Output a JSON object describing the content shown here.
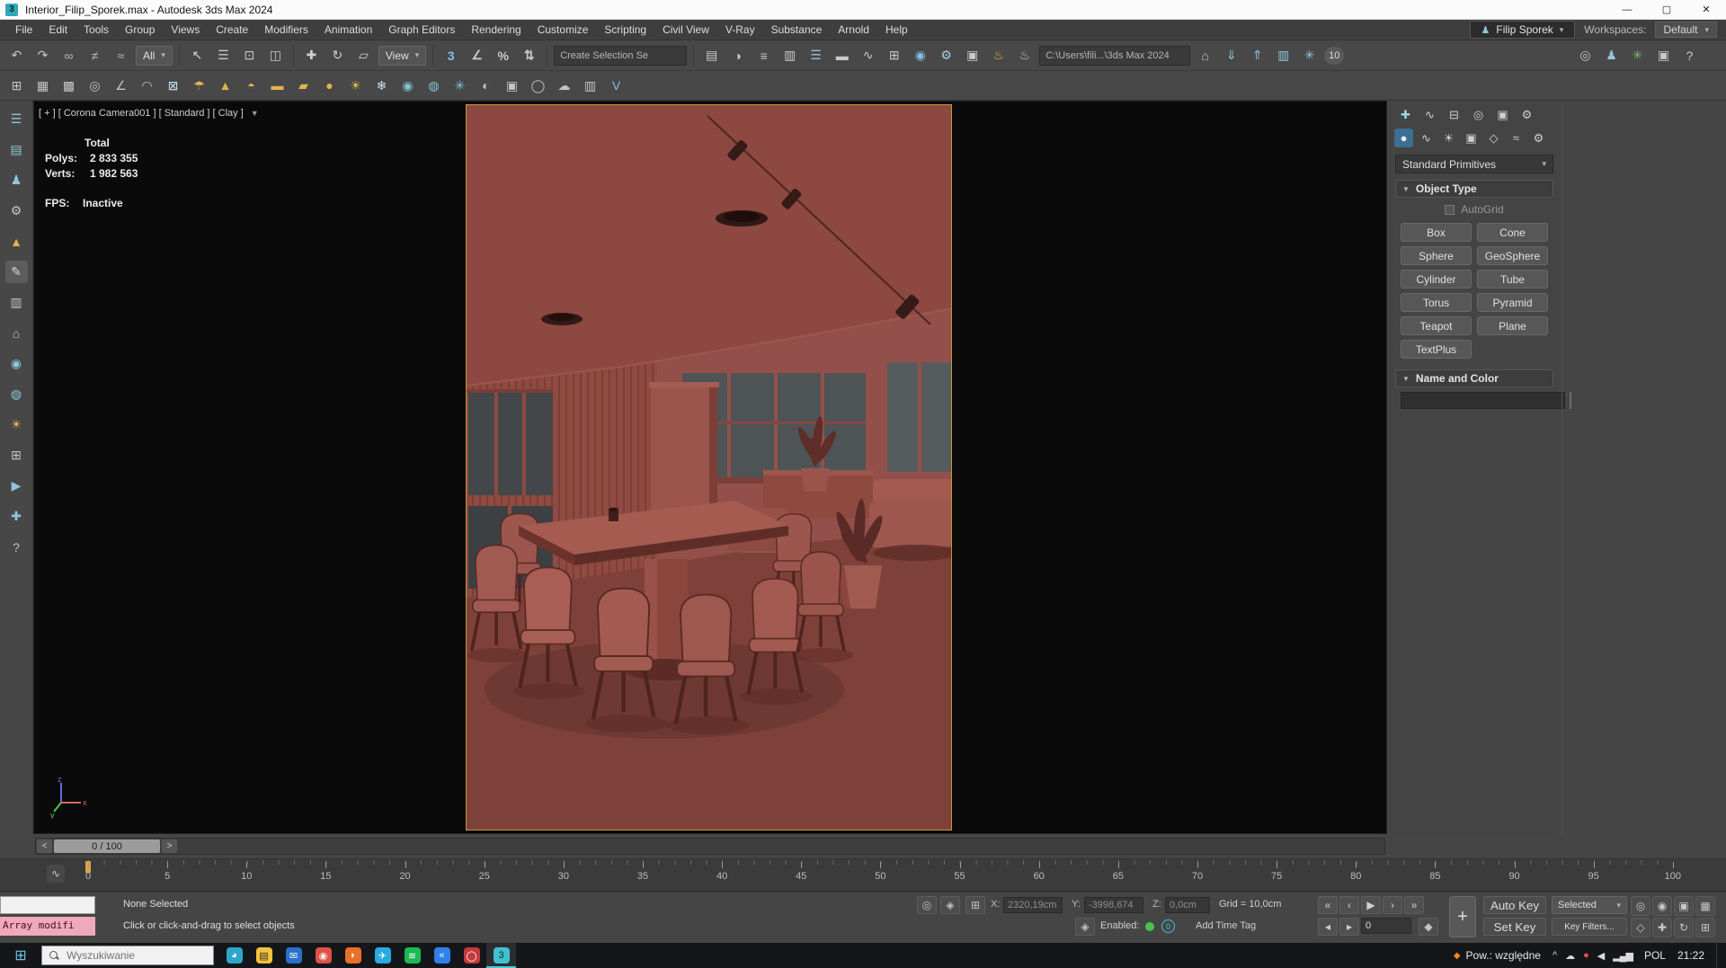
{
  "window": {
    "title": "Interior_Filip_Sporek.max - Autodesk 3ds Max 2024",
    "app_badge": "3",
    "minimize": "—",
    "maximize": "▢",
    "close": "✕"
  },
  "menu": {
    "items": [
      "File",
      "Edit",
      "Tools",
      "Group",
      "Views",
      "Create",
      "Modifiers",
      "Animation",
      "Graph Editors",
      "Rendering",
      "Customize",
      "Scripting",
      "Civil View",
      "V-Ray",
      "Substance",
      "Arnold",
      "Help"
    ],
    "user": "Filip Sporek",
    "user_icon": "♟",
    "workspaces_label": "Workspaces:",
    "workspace": "Default"
  },
  "toolbar_main": {
    "history_icons": [
      {
        "n": "undo-icon",
        "g": "↶",
        "c": "#c9c9c9"
      },
      {
        "n": "redo-icon",
        "g": "↷",
        "c": "#c9c9c9"
      },
      {
        "n": "select-and-link-icon",
        "g": "∞",
        "c": "#b8b8b8"
      },
      {
        "n": "unlink-selection-icon",
        "g": "≠",
        "c": "#b8b8b8"
      },
      {
        "n": "bind-to-space-warp-icon",
        "g": "≈",
        "c": "#b8b8b8"
      }
    ],
    "filter_dd": "All",
    "select_icons": [
      {
        "n": "select-object-icon",
        "g": "↖",
        "c": "#d8d8d8"
      },
      {
        "n": "select-by-name-icon",
        "g": "☰",
        "c": "#c9c9c9"
      },
      {
        "n": "rectangular-selection-icon",
        "g": "⊡",
        "c": "#c9c9c9"
      },
      {
        "n": "window-crossing-icon",
        "g": "◫",
        "c": "#c9c9c9"
      }
    ],
    "transform_icons": [
      {
        "n": "select-and-move-icon",
        "g": "✚",
        "c": "#d0d0d0"
      },
      {
        "n": "select-and-rotate-icon",
        "g": "↻",
        "c": "#d0d0d0"
      },
      {
        "n": "select-and-scale-icon",
        "g": "▱",
        "c": "#d0d0d0"
      }
    ],
    "view_dd": "View",
    "snap_icons": [
      {
        "n": "snaps-toggle-icon",
        "g": "3",
        "c": "#7ec1e0"
      },
      {
        "n": "angle-snap-icon",
        "g": "∠",
        "c": "#c9c9c9"
      },
      {
        "n": "percent-snap-icon",
        "g": "%",
        "c": "#c9c9c9"
      },
      {
        "n": "spinner-snap-icon",
        "g": "⇅",
        "c": "#c9c9c9"
      }
    ],
    "selection_set": "Create Selection Se",
    "edit_icons": [
      {
        "n": "edit-named-selections-icon",
        "g": "▤",
        "c": "#c9c9c9"
      },
      {
        "n": "mirror-icon",
        "g": "◑",
        "c": "#c9c9c9"
      },
      {
        "n": "align-icon",
        "g": "≡",
        "c": "#c9c9c9"
      },
      {
        "n": "layer-manager-icon",
        "g": "▥",
        "c": "#c9c9c9"
      },
      {
        "n": "scene-explorer-icon",
        "g": "☰",
        "c": "#8fc6d8"
      },
      {
        "n": "ribb0n-toggle-icon",
        "g": "▬",
        "c": "#c9c9c9"
      },
      {
        "n": "curve-editor-icon",
        "g": "∿",
        "c": "#c9c9c9"
      },
      {
        "n": "schematic-view-icon",
        "g": "⊞",
        "c": "#c9c9c9"
      },
      {
        "n": "material-editor-icon",
        "g": "◉",
        "c": "#7ec1e0"
      },
      {
        "n": "render-setup-icon",
        "g": "⚙",
        "c": "#9fd0e8"
      },
      {
        "n": "rendered-frame-icon",
        "g": "▣",
        "c": "#c9c9c9"
      },
      {
        "n": "render-production-icon",
        "g": "♨",
        "c": "#e3b34c"
      },
      {
        "n": "render-iterative-icon",
        "g": "♨",
        "c": "#9fd0e8"
      }
    ],
    "path": "C:\\Users\\fili...\\3ds Max 2024",
    "after_path_icons": [
      {
        "n": "project-folder-icon",
        "g": "⌂",
        "c": "#c9c9c9"
      },
      {
        "n": "import-icon",
        "g": "⇓",
        "c": "#8fc6d8"
      },
      {
        "n": "export-icon",
        "g": "⇑",
        "c": "#8fc6d8"
      },
      {
        "n": "open-script-icon",
        "g": "▥",
        "c": "#8fc6d8"
      },
      {
        "n": "mcg-icon",
        "g": "✳",
        "c": "#8fc6d8"
      }
    ],
    "badge": "10",
    "right_icons": [
      {
        "n": "arnold-icon",
        "g": "◎",
        "c": "#c9c9c9"
      },
      {
        "n": "populate-icon",
        "g": "♟",
        "c": "#8fc6d8"
      },
      {
        "n": "forest-icon",
        "g": "✳",
        "c": "#79b868"
      },
      {
        "n": "monitor-icon",
        "g": "▣",
        "c": "#c9c9c9"
      },
      {
        "n": "help-icon",
        "g": "?",
        "c": "#c9c9c9"
      }
    ]
  },
  "toolbar_second": {
    "icons": [
      {
        "n": "snap-grid-icon",
        "g": "⊞",
        "c": "#c4c4c4"
      },
      {
        "n": "modeling-ribbon-icon",
        "g": "▦",
        "c": "#c4c4c4"
      },
      {
        "n": "editable-poly-icon",
        "g": "▩",
        "c": "#c4c4c4"
      },
      {
        "n": "compass-icon",
        "g": "◎",
        "c": "#c4c4c4"
      },
      {
        "n": "measure-icon",
        "g": "∠",
        "c": "#c4c4c4"
      },
      {
        "n": "arc-tool-icon",
        "g": "◠",
        "c": "#c4c4c4"
      },
      {
        "n": "film-camera-icon",
        "g": "⊠",
        "c": "#bfe3ef"
      },
      {
        "n": "umbrella-light-icon",
        "g": "☂",
        "c": "#e3b34c"
      },
      {
        "n": "cone-light-icon",
        "g": "▲",
        "c": "#e3b34c"
      },
      {
        "n": "dome-light-icon",
        "g": "◓",
        "c": "#e3b34c"
      },
      {
        "n": "area-light-icon",
        "g": "▬",
        "c": "#e3b34c"
      },
      {
        "n": "plane-light-icon",
        "g": "▰",
        "c": "#e3b34c"
      },
      {
        "n": "sphere-light-icon",
        "g": "●",
        "c": "#e3b34c"
      },
      {
        "n": "sun-light-icon",
        "g": "☀",
        "c": "#e3b34c"
      },
      {
        "n": "snow-icon",
        "g": "❄",
        "c": "#cfe2ee"
      },
      {
        "n": "glass-sphere-icon",
        "g": "◉",
        "c": "#7fc3d8"
      },
      {
        "n": "soft-selection-icon",
        "g": "◍",
        "c": "#7fc3d8"
      },
      {
        "n": "cluster-icon",
        "g": "✳",
        "c": "#7fc3d8"
      },
      {
        "n": "camera-sequencer-icon",
        "g": "◐",
        "c": "#c4c4c4"
      },
      {
        "n": "physical-camera-icon",
        "g": "▣",
        "c": "#c4c4c4"
      },
      {
        "n": "lens-effects-icon",
        "g": "◯",
        "c": "#c4c4c4"
      },
      {
        "n": "environment-icon",
        "g": "☁",
        "c": "#c4c4c4"
      },
      {
        "n": "batch-render-icon",
        "g": "▥",
        "c": "#c4c4c4"
      },
      {
        "n": "vray-toolbar-icon",
        "g": "V",
        "c": "#8ab6e8"
      }
    ]
  },
  "left_toolbar": {
    "icons": [
      {
        "n": "scene-explorer-icon",
        "g": "☰",
        "c": "#8fc6d8",
        "cls": ""
      },
      {
        "n": "layer-explorer-icon",
        "g": "▤",
        "c": "#8fc6d8",
        "cls": ""
      },
      {
        "n": "character-icon",
        "g": "♟",
        "c": "#8fc6d8",
        "cls": ""
      },
      {
        "n": "bone-tools-icon",
        "g": "⚙",
        "c": "#c4c4c4",
        "cls": ""
      },
      {
        "n": "cone-helper-icon",
        "g": "▲",
        "c": "#e3b34c",
        "cls": ""
      },
      {
        "n": "pencil-icon",
        "g": "✎",
        "c": "#d8d8d8",
        "cls": "active"
      },
      {
        "n": "notes-icon",
        "g": "▥",
        "c": "#c4c4c4",
        "cls": ""
      },
      {
        "n": "home-icon",
        "g": "⌂",
        "c": "#c4c4c4",
        "cls": ""
      },
      {
        "n": "sphere-check-icon",
        "g": "◉",
        "c": "#8fc6d8",
        "cls": ""
      },
      {
        "n": "world-icon",
        "g": "◍",
        "c": "#8fc6d8",
        "cls": ""
      },
      {
        "n": "light-icon",
        "g": "☀",
        "c": "#e3b34c",
        "cls": ""
      },
      {
        "n": "grid-icon",
        "g": "⊞",
        "c": "#c4c4c4",
        "cls": ""
      },
      {
        "n": "play-script-icon",
        "g": "▶",
        "c": "#8fc6d8",
        "cls": ""
      },
      {
        "n": "add-icon",
        "g": "✚",
        "c": "#8fc6d8",
        "cls": ""
      },
      {
        "n": "help-icon",
        "g": "?",
        "c": "#c4c4c4",
        "cls": ""
      }
    ]
  },
  "viewport": {
    "label": "[ + ] [ Corona Camera001 ] [ Standard ] [ Clay ]",
    "filter_glyph": "▼",
    "stats": {
      "total_label": "Total",
      "polys_label": "Polys:",
      "polys_value": "2 833 355",
      "verts_label": "Verts:",
      "verts_value": "1 982 563",
      "fps_label": "FPS:",
      "fps_value": "Inactive"
    },
    "axis": {
      "x": "x",
      "y": "y",
      "z": "z"
    }
  },
  "command_panel": {
    "tabs": [
      {
        "n": "tab-create",
        "g": "✚",
        "c": "#9fd4e2",
        "cls": "active"
      },
      {
        "n": "tab-modify",
        "g": "∿",
        "c": "#cfcfcf",
        "cls": ""
      },
      {
        "n": "tab-hierarchy",
        "g": "⊟",
        "c": "#cfcfcf",
        "cls": ""
      },
      {
        "n": "tab-motion",
        "g": "◎",
        "c": "#cfcfcf",
        "cls": ""
      },
      {
        "n": "tab-display",
        "g": "▣",
        "c": "#cfcfcf",
        "cls": ""
      },
      {
        "n": "tab-utilities",
        "g": "⚙",
        "c": "#cfcfcf",
        "cls": ""
      }
    ],
    "categories": [
      {
        "n": "category-geometry",
        "g": "●",
        "c": "#eaeaea",
        "cls": "active"
      },
      {
        "n": "category-shapes",
        "g": "∿",
        "c": "#cfcfcf",
        "cls": ""
      },
      {
        "n": "category-lights",
        "g": "☀",
        "c": "#cfcfcf",
        "cls": ""
      },
      {
        "n": "category-cameras",
        "g": "▣",
        "c": "#cfcfcf",
        "cls": ""
      },
      {
        "n": "category-helpers",
        "g": "◇",
        "c": "#cfcfcf",
        "cls": ""
      },
      {
        "n": "category-spacewarps",
        "g": "≈",
        "c": "#cfcfcf",
        "cls": ""
      },
      {
        "n": "category-systems",
        "g": "⚙",
        "c": "#cfcfcf",
        "cls": ""
      }
    ],
    "dropdown": "Standard Primitives",
    "object_type": {
      "title": "Object Type",
      "autogrid": "AutoGrid",
      "buttons": [
        "Box",
        "Cone",
        "Sphere",
        "GeoSphere",
        "Cylinder",
        "Tube",
        "Torus",
        "Pyramid",
        "Teapot",
        "Plane",
        "TextPlus"
      ]
    },
    "name_color": {
      "title": "Name and Color"
    }
  },
  "timeline": {
    "prev": "<",
    "next": ">",
    "slider_value": "0 / 100",
    "mini_curve_glyph": "∿",
    "ticks": [
      "0",
      "5",
      "10",
      "15",
      "20",
      "25",
      "30",
      "35",
      "40",
      "45",
      "50",
      "55",
      "60",
      "65",
      "70",
      "75",
      "80",
      "85",
      "90",
      "95",
      "100"
    ]
  },
  "status": {
    "listener_macro": "Array modifi",
    "prompt_line1": "None Selected",
    "prompt_line2": "Click or click-and-drag to select objects",
    "isolate_glyph": "◎",
    "lock_glyph": "◈",
    "typein_glyph": "⊞",
    "x_label": "X:",
    "x_value": "2320,19cm",
    "y_label": "Y:",
    "y_value": "-3998,674",
    "z_label": "Z:",
    "z_value": "0,0cm",
    "grid": "Grid = 10,0cm",
    "playback": [
      {
        "n": "go-to-start-button",
        "g": "«"
      },
      {
        "n": "previous-key-button",
        "g": "‹"
      },
      {
        "n": "play-button",
        "g": "▶"
      },
      {
        "n": "next-key-button",
        "g": "›"
      },
      {
        "n": "go-to-end-button",
        "g": "»"
      }
    ],
    "plus_glyph": "+",
    "auto_key": "Auto Key",
    "set_key": "Set Key",
    "selected_dd": "Selected",
    "key_filters": "Key Filters...",
    "enabled_label": "Enabled:",
    "time_tag_badge": "0",
    "time_tag_icon_glyph": "◈",
    "add_time_tag": "Add Time Tag",
    "prev_frame_glyph": "◂",
    "next_frame_glyph": "▸",
    "frame_value": "0",
    "key_mode_glyph": "◆",
    "nav_icons": [
      {
        "n": "zoom-icon",
        "g": "◎"
      },
      {
        "n": "zoom-all-icon",
        "g": "◉"
      },
      {
        "n": "zoom-extents-icon",
        "g": "▣"
      },
      {
        "n": "zoom-extents-all-icon",
        "g": "▦"
      },
      {
        "n": "field-of-view-icon",
        "g": "◇"
      },
      {
        "n": "pan-icon",
        "g": "✚"
      },
      {
        "n": "orbit-icon",
        "g": "↻"
      },
      {
        "n": "maximize-viewport-icon",
        "g": "⊞"
      }
    ]
  },
  "taskbar": {
    "start_glyph": "⊞",
    "search_placeholder": "Wyszukiwanie",
    "apps": [
      {
        "n": "edge-icon",
        "g": "◕",
        "c": "#ffffff",
        "bg": "#2da7c9",
        "cls": ""
      },
      {
        "n": "file-explorer-icon",
        "g": "▤",
        "c": "#2b2b2b",
        "bg": "#f3c23c",
        "cls": ""
      },
      {
        "n": "mail-icon",
        "g": "✉",
        "c": "#ffffff",
        "bg": "#2970c9",
        "cls": ""
      },
      {
        "n": "chrome-icon",
        "g": "◉",
        "c": "#f6f6f6",
        "bg": "#de5145",
        "cls": ""
      },
      {
        "n": "firefox-icon",
        "g": "◗",
        "c": "#ffffff",
        "bg": "#e8702a",
        "cls": ""
      },
      {
        "n": "telegram-icon",
        "g": "✈",
        "c": "#ffffff",
        "bg": "#2aabdf",
        "cls": ""
      },
      {
        "n": "spotify-icon",
        "g": "≋",
        "c": "#ffffff",
        "bg": "#1db954",
        "cls": ""
      },
      {
        "n": "vscode-icon",
        "g": "«",
        "c": "#ffffff",
        "bg": "#2f80ed",
        "cls": ""
      },
      {
        "n": "opera-icon",
        "g": "◯",
        "c": "#ffffff",
        "bg": "#c23b3b",
        "cls": ""
      },
      {
        "n": "3dsmax-icon",
        "g": "3",
        "c": "#06282d",
        "bg": "#3fc1d1",
        "cls": "active"
      }
    ],
    "power_icon_glyph": "◆",
    "power_label": "Pow.: względne",
    "tray_icons": [
      {
        "n": "hidden-icons-chevron",
        "g": "^",
        "c": "#dadada"
      },
      {
        "n": "onedrive-icon",
        "g": "☁",
        "c": "#dadada"
      },
      {
        "n": "recording-icon",
        "g": "●",
        "c": "#e05555"
      },
      {
        "n": "volume-icon",
        "g": "◀",
        "c": "#dadada"
      },
      {
        "n": "network-icon",
        "g": "▂▄▆",
        "c": "#dadada"
      }
    ],
    "lang": "POL",
    "time": "21:22"
  }
}
